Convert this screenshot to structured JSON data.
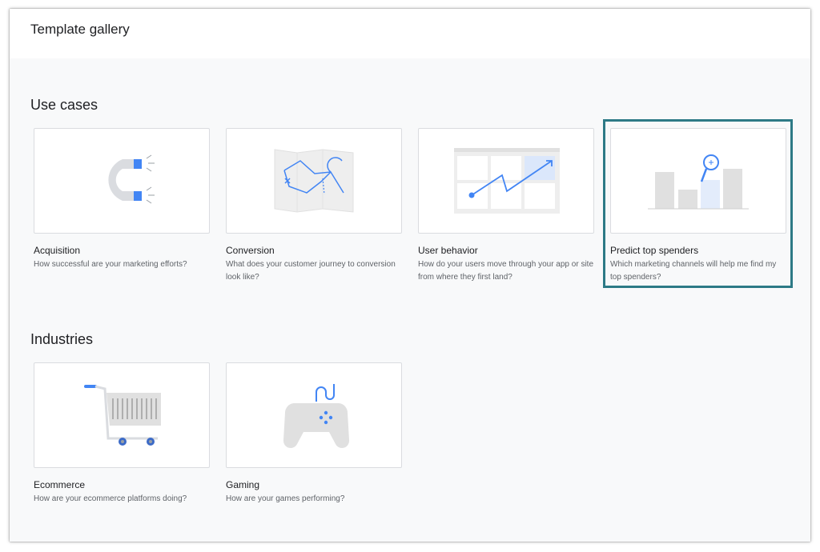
{
  "header": {
    "title": "Template gallery"
  },
  "sections": {
    "use_cases": {
      "title": "Use cases",
      "cards": [
        {
          "title": "Acquisition",
          "description": "How successful are your marketing efforts?",
          "icon": "magnet-icon"
        },
        {
          "title": "Conversion",
          "description": "What does your customer journey to conversion look like?",
          "icon": "map-icon"
        },
        {
          "title": "User behavior",
          "description": "How do your users move through your app or site from where they first land?",
          "icon": "user-path-icon"
        },
        {
          "title": "Predict top spenders",
          "description": "Which marketing channels will help me find my top spenders?",
          "icon": "bar-chart-search-icon"
        }
      ]
    },
    "industries": {
      "title": "Industries",
      "cards": [
        {
          "title": "Ecommerce",
          "description": "How are your ecommerce platforms doing?",
          "icon": "shopping-cart-icon"
        },
        {
          "title": "Gaming",
          "description": "How are your games performing?",
          "icon": "game-controller-icon"
        }
      ]
    }
  },
  "colors": {
    "accent_blue": "#4285f4",
    "highlight_border": "#2d7a86",
    "illustration_gray": "#dadce0"
  }
}
